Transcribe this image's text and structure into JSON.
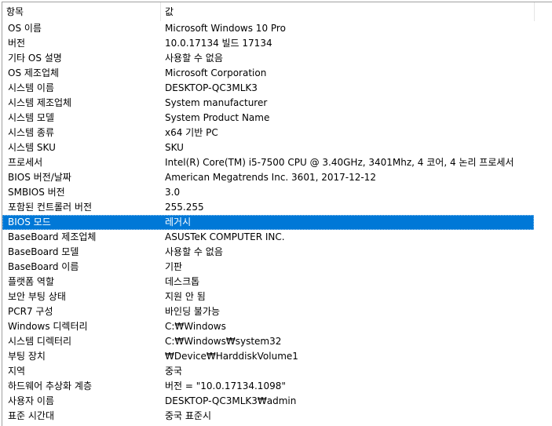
{
  "header": {
    "item": "항목",
    "value": "값"
  },
  "selected_row": 14,
  "colors": {
    "selection": "#0078d7"
  },
  "rows": [
    {
      "item": "OS 이름",
      "value": "Microsoft Windows 10 Pro"
    },
    {
      "item": "버전",
      "value": "10.0.17134 빌드 17134"
    },
    {
      "item": "기타 OS 설명",
      "value": "사용할 수 없음"
    },
    {
      "item": "OS 제조업체",
      "value": "Microsoft Corporation"
    },
    {
      "item": "시스템 이름",
      "value": "DESKTOP-QC3MLK3"
    },
    {
      "item": "시스템 제조업체",
      "value": "System manufacturer"
    },
    {
      "item": "시스템 모델",
      "value": "System Product Name"
    },
    {
      "item": "시스템 종류",
      "value": "x64 기반 PC"
    },
    {
      "item": "시스템 SKU",
      "value": "SKU"
    },
    {
      "item": "프로세서",
      "value": "Intel(R) Core(TM) i5-7500 CPU @ 3.40GHz, 3401Mhz, 4 코어, 4 논리 프로세서"
    },
    {
      "item": "BIOS 버전/날짜",
      "value": "American Megatrends Inc. 3601, 2017-12-12"
    },
    {
      "item": "SMBIOS 버전",
      "value": "3.0"
    },
    {
      "item": "포함된 컨트롤러 버전",
      "value": "255.255"
    },
    {
      "item": "BIOS 모드",
      "value": "레거시"
    },
    {
      "item": "BaseBoard 제조업체",
      "value": "ASUSTeK COMPUTER INC."
    },
    {
      "item": "BaseBoard 모델",
      "value": "사용할 수 없음"
    },
    {
      "item": "BaseBoard 이름",
      "value": "기판"
    },
    {
      "item": "플랫폼 역할",
      "value": "데스크톱"
    },
    {
      "item": "보안 부팅 상태",
      "value": "지원 안 됨"
    },
    {
      "item": "PCR7 구성",
      "value": "바인딩 불가능"
    },
    {
      "item": "Windows 디렉터리",
      "value": "C:₩Windows"
    },
    {
      "item": "시스템 디렉터리",
      "value": "C:₩Windows₩system32"
    },
    {
      "item": "부팅 장치",
      "value": "₩Device₩HarddiskVolume1"
    },
    {
      "item": "지역",
      "value": "중국"
    },
    {
      "item": "하드웨어 추상화 계층",
      "value": "버전 = \"10.0.17134.1098\""
    },
    {
      "item": "사용자 이름",
      "value": "DESKTOP-QC3MLK3₩admin"
    },
    {
      "item": "표준 시간대",
      "value": "중국 표준시"
    }
  ]
}
